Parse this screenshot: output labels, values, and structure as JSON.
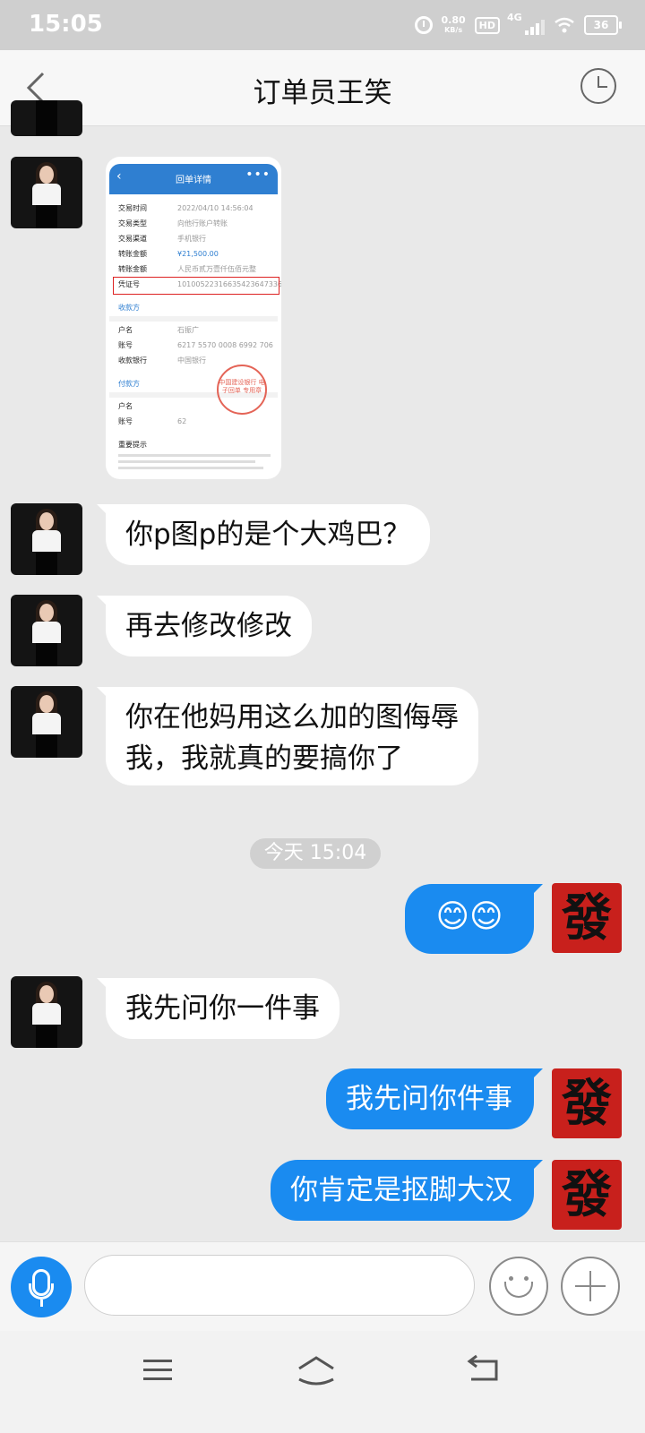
{
  "status_bar": {
    "time": "15:05",
    "net_speed_value": "0.80",
    "net_speed_unit": "KB/s",
    "hd": "HD",
    "network": "4G",
    "battery": "36"
  },
  "header": {
    "title": "订单员王笑",
    "back_icon": "chevron-left-icon",
    "history_icon": "clock-icon"
  },
  "receipt": {
    "header_title": "回单详情",
    "more": "•••",
    "rows": [
      {
        "label": "交易时间",
        "value": "2022/04/10  14:56:04"
      },
      {
        "label": "交易类型",
        "value": "向他行账户转账"
      },
      {
        "label": "交易渠道",
        "value": "手机银行"
      },
      {
        "label": "转账金额",
        "value": "¥21,500.00"
      },
      {
        "label": "转账金额",
        "value": "人民币贰万壹仟伍佰元整"
      },
      {
        "label": "凭证号",
        "value": "10100522316635423647336"
      }
    ],
    "payee_section": "收款方",
    "payee_rows": [
      {
        "label": "户名",
        "value": "石振广"
      },
      {
        "label": "账号",
        "value": "6217 5570 0008 6992 706"
      },
      {
        "label": "收款银行",
        "value": "中国银行"
      }
    ],
    "payer_section": "付款方",
    "payer_rows": [
      {
        "label": "户名",
        "value": ""
      },
      {
        "label": "账号",
        "value": "62"
      }
    ],
    "stamp": "中国建设银行 电子回单 专用章",
    "notes_title": "重要提示"
  },
  "messages": [
    {
      "id": "m1",
      "side": "in",
      "text": "你p图p的是个大鸡巴？"
    },
    {
      "id": "m2",
      "side": "in",
      "text": "再去修改修改"
    },
    {
      "id": "m3",
      "side": "in",
      "line1": "你在他妈用这么加的图侮辱",
      "line2": "我，我就真的要搞你了"
    },
    {
      "id": "m4",
      "side": "out",
      "text": "😊😊"
    },
    {
      "id": "m5",
      "side": "in",
      "text": "我先问你一件事"
    },
    {
      "id": "m6",
      "side": "out",
      "text": "我先问你件事"
    },
    {
      "id": "m7",
      "side": "out",
      "text": "你肯定是抠脚大汉"
    }
  ],
  "timestamp": "今天 15:04",
  "my_avatar_char": "發",
  "input_bar": {
    "placeholder": "",
    "voice_icon": "microphone-icon",
    "emoji_icon": "smiley-icon",
    "plus_icon": "plus-icon"
  },
  "colors": {
    "accent": "#1a8bf0",
    "background": "#e9e9e9",
    "my_avatar_bg": "#c8201c"
  }
}
